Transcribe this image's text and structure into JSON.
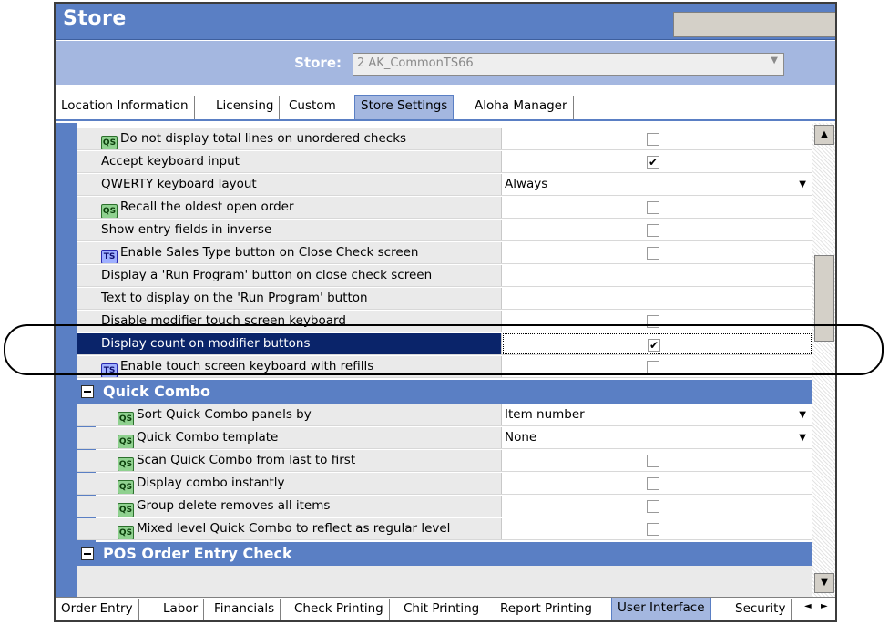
{
  "window": {
    "title": "Store",
    "store_label": "Store:",
    "store_value": "2 AK_CommonTS66"
  },
  "top_tabs": [
    {
      "label": "Location Information",
      "active": false
    },
    {
      "label": "Licensing",
      "active": false
    },
    {
      "label": "Custom",
      "active": false
    },
    {
      "label": "Store Settings",
      "active": true
    },
    {
      "label": "Aloha Manager",
      "active": false
    }
  ],
  "rows": [
    {
      "badge": "QS",
      "label": "Do not display total lines on unordered checks",
      "type": "checkbox",
      "checked": false
    },
    {
      "badge": "",
      "label": "Accept keyboard input",
      "type": "checkbox",
      "checked": true
    },
    {
      "badge": "",
      "label": "QWERTY keyboard layout",
      "type": "dropdown",
      "value": "Always"
    },
    {
      "badge": "QS",
      "label": "Recall the oldest open order",
      "type": "checkbox",
      "checked": false
    },
    {
      "badge": "",
      "label": "Show entry fields in inverse",
      "type": "checkbox",
      "checked": false
    },
    {
      "badge": "TS",
      "label": "Enable Sales Type button on Close Check screen",
      "type": "checkbox",
      "checked": false
    },
    {
      "badge": "",
      "label": "Display a 'Run Program' button on close check screen",
      "type": "empty"
    },
    {
      "badge": "",
      "label": "Text to display on the 'Run Program' button",
      "type": "empty"
    },
    {
      "badge": "",
      "label": "Disable modifier touch screen keyboard",
      "type": "checkbox",
      "checked": false
    },
    {
      "badge": "",
      "label": "Display count on modifier buttons",
      "type": "checkbox",
      "checked": true,
      "selected": true
    },
    {
      "badge": "TS",
      "label": "Enable touch screen keyboard with refills",
      "type": "checkbox",
      "checked": false
    }
  ],
  "groups": [
    {
      "title": "Quick Combo",
      "rows": [
        {
          "badge": "QS",
          "label": "Sort Quick Combo panels by",
          "type": "dropdown",
          "value": "Item number"
        },
        {
          "badge": "QS",
          "label": "Quick Combo template",
          "type": "dropdown",
          "value": "None"
        },
        {
          "badge": "QS",
          "label": "Scan Quick Combo from last to first",
          "type": "checkbox",
          "checked": false
        },
        {
          "badge": "QS",
          "label": "Display combo instantly",
          "type": "checkbox",
          "checked": false
        },
        {
          "badge": "QS",
          "label": "Group delete removes all items",
          "type": "checkbox",
          "checked": false
        },
        {
          "badge": "QS",
          "label": "Mixed level Quick Combo to reflect as regular level",
          "type": "checkbox",
          "checked": false
        }
      ]
    },
    {
      "title": "POS Order Entry Check",
      "rows": []
    }
  ],
  "bottom_tabs": [
    {
      "label": "Order Entry",
      "active": false
    },
    {
      "label": "Labor",
      "active": false
    },
    {
      "label": "Financials",
      "active": false
    },
    {
      "label": "Check Printing",
      "active": false
    },
    {
      "label": "Chit Printing",
      "active": false
    },
    {
      "label": "Report Printing",
      "active": false
    },
    {
      "label": "User Interface",
      "active": true
    },
    {
      "label": "Security",
      "active": false
    }
  ],
  "glyphs": {
    "checkmark": "✔",
    "dropdown_arrow": "▼",
    "scroll_up": "▲",
    "scroll_down": "▼",
    "tab_prev": "◄",
    "tab_next": "►"
  },
  "colors": {
    "accent": "#5a7fc4",
    "accent_light": "#a4b7e0",
    "selected_row": "#0a246a"
  }
}
